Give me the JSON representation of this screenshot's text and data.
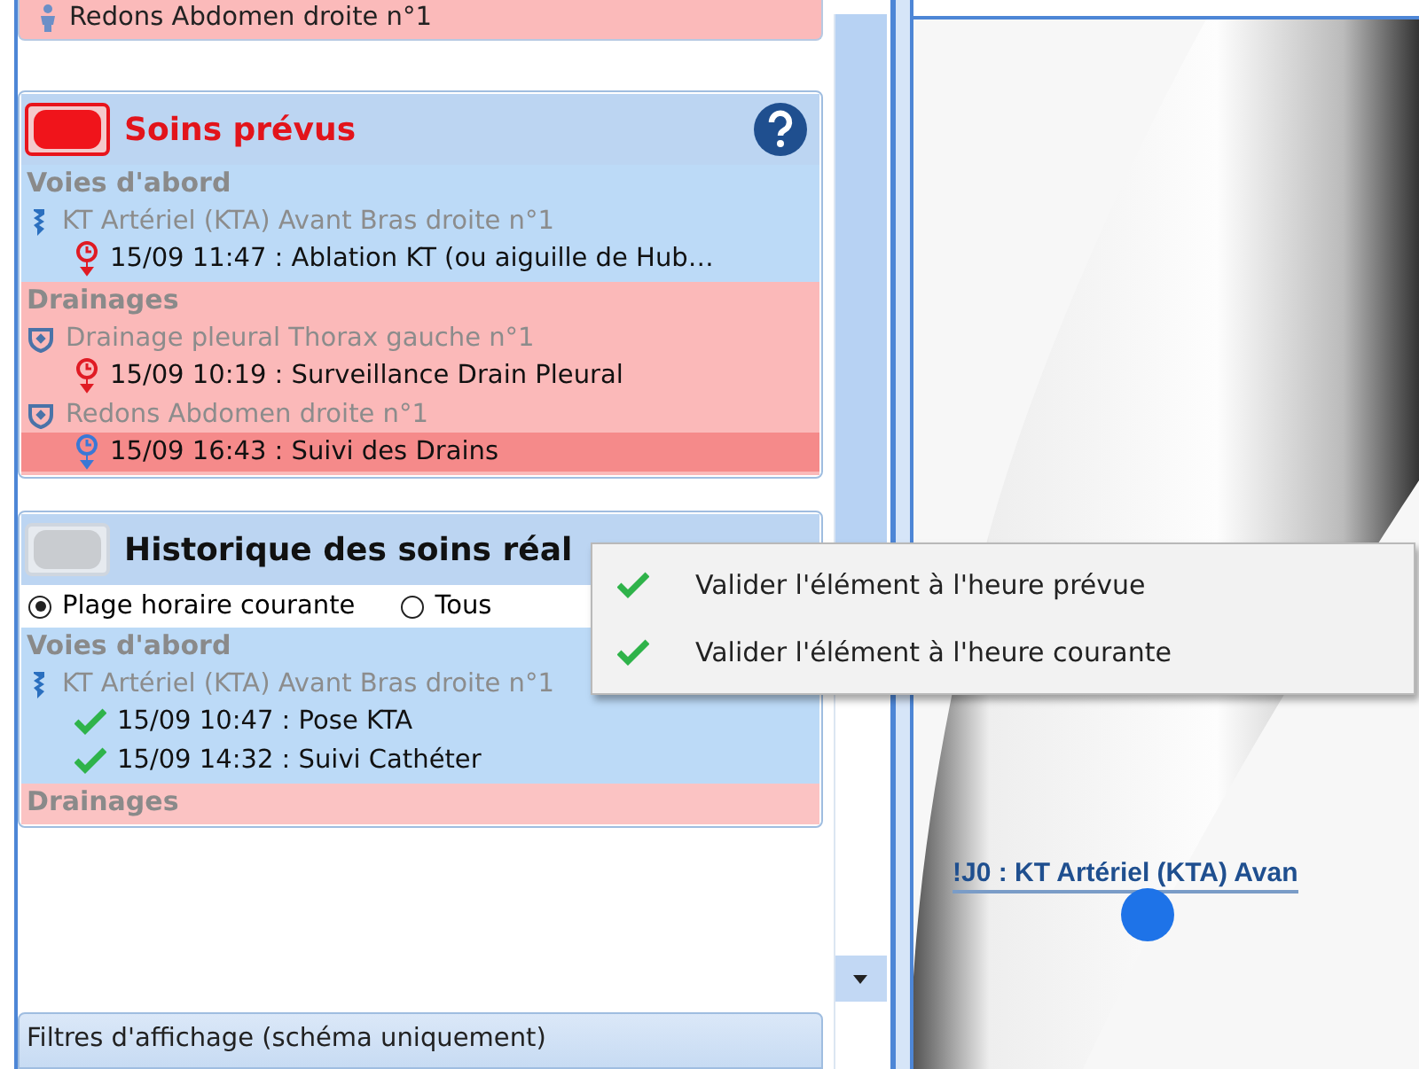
{
  "top_item": {
    "kind": "figure",
    "label": "Redons Abdomen droite n°1"
  },
  "planned": {
    "title": "Soins prévus",
    "active": true,
    "groups": [
      {
        "title": "Voies d'abord",
        "color": "#bcdaf7",
        "devices": [
          {
            "kind": "catheter",
            "label": "KT Artériel (KTA) Avant Bras droite n°1",
            "cares": [
              {
                "kind": "overdue",
                "text": "15/09 11:47 : Ablation KT (ou aiguille de Hub…",
                "selected": false
              }
            ]
          }
        ]
      },
      {
        "title": "Drainages",
        "color": "#fbb9b9",
        "devices": [
          {
            "kind": "drain",
            "label": "Drainage pleural Thorax gauche n°1",
            "cares": [
              {
                "kind": "overdue",
                "text": "15/09 10:19 : Surveillance Drain Pleural",
                "selected": false
              }
            ]
          },
          {
            "kind": "drain",
            "label": "Redons Abdomen droite n°1",
            "cares": [
              {
                "kind": "upcoming",
                "text": "15/09 16:43 : Suivi des Drains",
                "selected": true
              }
            ]
          }
        ]
      }
    ]
  },
  "history": {
    "title": "Historique des soins réal",
    "active": false,
    "filters": [
      {
        "label": "Plage horaire courante",
        "selected": true
      },
      {
        "label": "Tous",
        "selected": false
      }
    ],
    "groups": [
      {
        "title": "Voies d'abord",
        "color": "#bcdaf7",
        "devices": [
          {
            "kind": "catheter",
            "label": "KT Artériel (KTA) Avant Bras droite n°1",
            "cares": [
              {
                "kind": "done",
                "text": "15/09 10:47 : Pose KTA",
                "selected": false
              },
              {
                "kind": "done",
                "text": "15/09 14:32 : Suivi Cathéter",
                "selected": false
              }
            ]
          }
        ]
      },
      {
        "title": "Drainages",
        "color": "#fbc3c3"
      }
    ]
  },
  "filters_bar": {
    "label": "Filtres d'affichage (schéma uniquement)"
  },
  "scene": {
    "label": "!J0 : KT Artériel (KTA) Avan"
  },
  "context_menu": {
    "items": [
      {
        "label": "Valider l'élément à l'heure prévue"
      },
      {
        "label": "Valider l'élément à l'heure courante"
      }
    ]
  }
}
